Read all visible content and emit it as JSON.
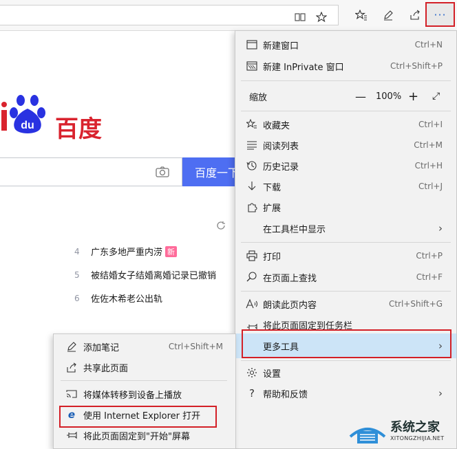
{
  "browser": {
    "more_label": "···"
  },
  "page": {
    "logo_text": "百度",
    "search_button": "百度一下",
    "hot_list": [
      {
        "num": "4",
        "text": "广东多地严重内涝",
        "badge": "新"
      },
      {
        "num": "5",
        "text": "被结婚女子结婚离婚记录已撤销",
        "badge": ""
      },
      {
        "num": "6",
        "text": "佐佐木希老公出轨",
        "badge": ""
      }
    ]
  },
  "menu": {
    "new_window": {
      "label": "新建窗口",
      "shortcut": "Ctrl+N"
    },
    "new_inprivate": {
      "label": "新建 InPrivate 窗口",
      "shortcut": "Ctrl+Shift+P"
    },
    "zoom": {
      "label": "缩放",
      "minus": "—",
      "value": "100%",
      "plus": "+",
      "fullscreen": "⤢"
    },
    "favorites": {
      "label": "收藏夹",
      "shortcut": "Ctrl+I"
    },
    "reading_list": {
      "label": "阅读列表",
      "shortcut": "Ctrl+M"
    },
    "history": {
      "label": "历史记录",
      "shortcut": "Ctrl+H"
    },
    "downloads": {
      "label": "下载",
      "shortcut": "Ctrl+J"
    },
    "extensions": {
      "label": "扩展"
    },
    "show_in_toolbar": {
      "label": "在工具栏中显示"
    },
    "print": {
      "label": "打印",
      "shortcut": "Ctrl+P"
    },
    "find": {
      "label": "在页面上查找",
      "shortcut": "Ctrl+F"
    },
    "read_aloud": {
      "label": "朗读此页内容",
      "shortcut": "Ctrl+Shift+G"
    },
    "pin_taskbar": {
      "label": "将此页面固定到任务栏"
    },
    "more_tools": {
      "label": "更多工具"
    },
    "settings": {
      "label": "设置"
    },
    "help": {
      "label": "帮助和反馈"
    }
  },
  "submenu": {
    "add_notes": {
      "label": "添加笔记",
      "shortcut": "Ctrl+Shift+M"
    },
    "share": {
      "label": "共享此页面"
    },
    "cast": {
      "label": "将媒体转移到设备上播放"
    },
    "open_ie": {
      "label": "使用 Internet Explorer 打开"
    },
    "pin_start": {
      "label": "将此页面固定到\"开始\"屏幕"
    }
  },
  "watermark": {
    "title": "系统之家",
    "url": "XITONGZHIJIA.NET"
  },
  "colors": {
    "highlight": "#cce4f7",
    "annotation_red": "#d31f26",
    "baidu_blue": "#4e6ef2",
    "baidu_red": "#d9232e"
  }
}
